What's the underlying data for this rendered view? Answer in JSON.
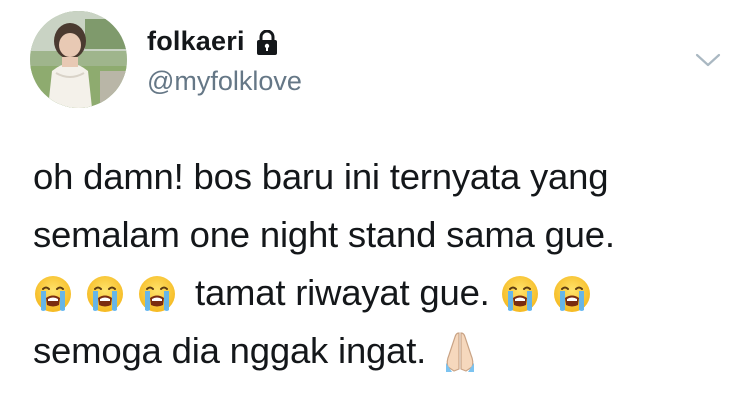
{
  "user": {
    "display_name": "folkaeri",
    "handle": "@myfolklove",
    "avatar_icon": "profile-photo",
    "protected_icon": "lock-icon"
  },
  "menu_icon": "chevron-down-icon",
  "tweet": {
    "line1": "oh damn! bos baru ini ternyata yang",
    "line2": "semalam one night stand sama gue.",
    "line3_text": "tamat riwayat gue.",
    "line4_text": "semoga dia nggak ingat.",
    "emojis": {
      "crying": "loudly-crying-face-emoji",
      "pray": "folded-hands-emoji"
    }
  },
  "colors": {
    "text": "#14171a",
    "secondary": "#657786",
    "chevron": "#aab8c2"
  }
}
